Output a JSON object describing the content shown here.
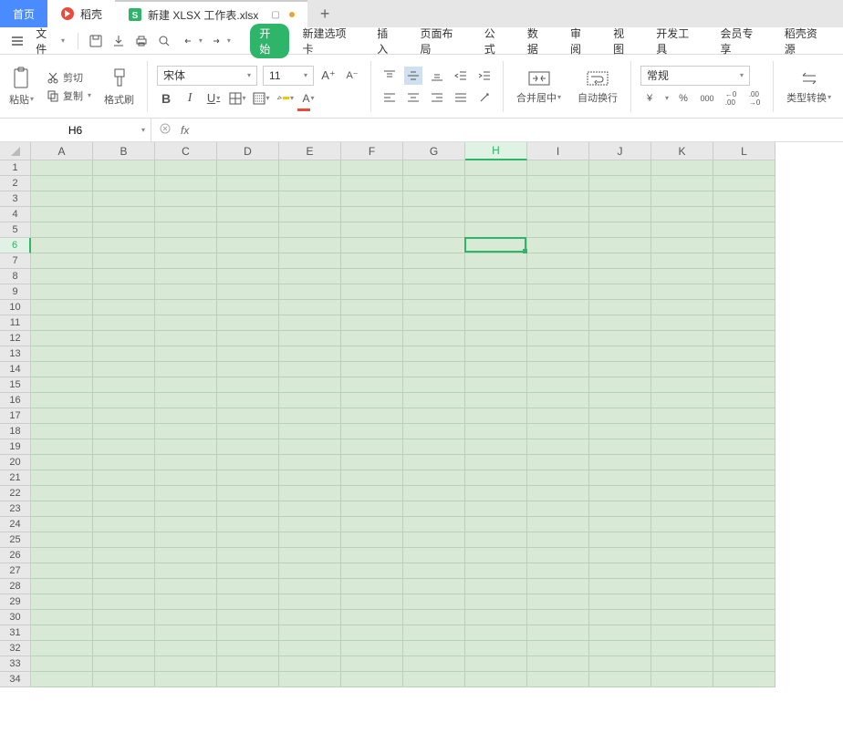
{
  "tabs": {
    "home": "首页",
    "daocao": "稻壳",
    "active": "新建 XLSX 工作表.xlsx"
  },
  "menu": {
    "file": "文件",
    "tabs": [
      "开始",
      "新建选项卡",
      "插入",
      "页面布局",
      "公式",
      "数据",
      "审阅",
      "视图",
      "开发工具",
      "会员专享",
      "稻壳资源"
    ]
  },
  "ribbon": {
    "paste": "粘贴",
    "cut": "剪切",
    "copy": "复制",
    "format_painter": "格式刷",
    "font_name": "宋体",
    "font_size": "11",
    "merge_center": "合并居中",
    "wrap_text": "自动换行",
    "number_format": "常规",
    "currency": "¥",
    "percent": "%",
    "thousand": "000",
    "inc_dec": "←0 .00",
    "dec_inc": ".00 →0",
    "type_convert": "类型转换"
  },
  "namebox": {
    "value": "H6"
  },
  "formula": {
    "fx": "fx",
    "value": ""
  },
  "columns": [
    "A",
    "B",
    "C",
    "D",
    "E",
    "F",
    "G",
    "H",
    "I",
    "J",
    "K",
    "L"
  ],
  "selected": {
    "col": "H",
    "row": 6,
    "colIndex": 7,
    "rowIndex": 5
  },
  "rowCount": 34
}
